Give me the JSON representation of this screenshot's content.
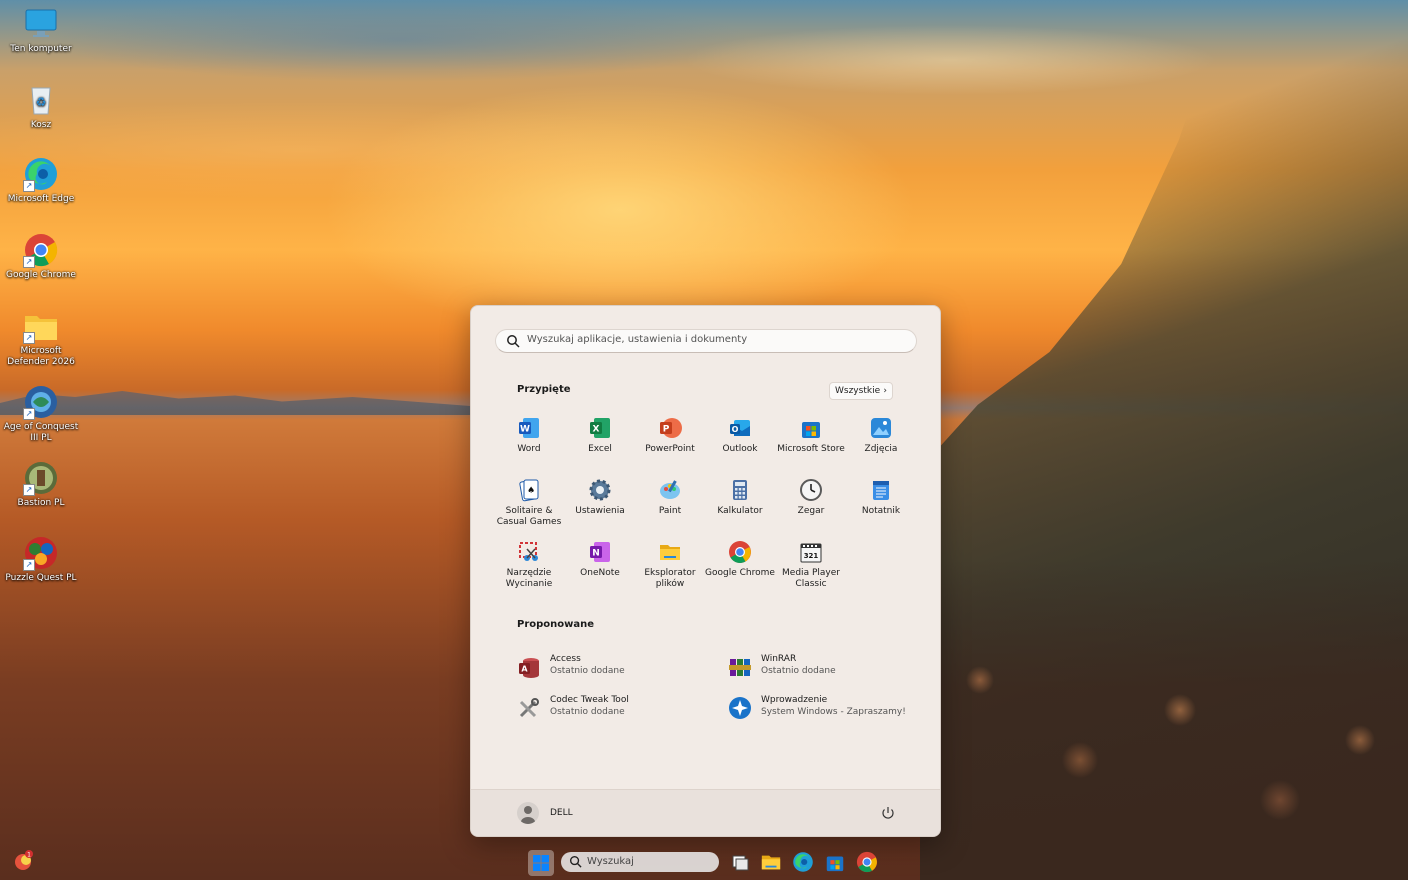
{
  "desktop": {
    "icons": [
      {
        "label": "Ten komputer",
        "icon": "monitor-icon"
      },
      {
        "label": "Kosz",
        "icon": "recycle-bin-icon"
      },
      {
        "label": "Microsoft Edge",
        "icon": "edge-icon"
      },
      {
        "label": "Google Chrome",
        "icon": "chrome-icon"
      },
      {
        "label": "Microsoft Defender 2026",
        "icon": "folder-icon"
      },
      {
        "label": "Age of Conquest III PL",
        "icon": "game-icon"
      },
      {
        "label": "Bastion PL",
        "icon": "game-icon"
      },
      {
        "label": "Puzzle Quest PL",
        "icon": "game-icon"
      }
    ]
  },
  "start_menu": {
    "search_placeholder": "Wyszukaj aplikacje, ustawienia i dokumenty",
    "pinned_title": "Przypięte",
    "all_button": "Wszystkie",
    "pinned": [
      {
        "label": "Word",
        "icon": "word-icon",
        "color": "#185abd"
      },
      {
        "label": "Excel",
        "icon": "excel-icon",
        "color": "#107c41"
      },
      {
        "label": "PowerPoint",
        "icon": "powerpoint-icon",
        "color": "#c43e1c"
      },
      {
        "label": "Outlook",
        "icon": "outlook-icon",
        "color": "#0f6cbd"
      },
      {
        "label": "Microsoft Store",
        "icon": "store-icon",
        "color": "#1a73c9"
      },
      {
        "label": "Zdjęcia",
        "icon": "photos-icon",
        "color": "#2b88d8"
      },
      {
        "label": "Solitaire & Casual Games",
        "icon": "solitaire-icon",
        "color": "#1e5aa8"
      },
      {
        "label": "Ustawienia",
        "icon": "settings-icon",
        "color": "#4f6f8f"
      },
      {
        "label": "Paint",
        "icon": "paint-icon",
        "color": "#2f9cd8"
      },
      {
        "label": "Kalkulator",
        "icon": "calculator-icon",
        "color": "#4a6fa5"
      },
      {
        "label": "Zegar",
        "icon": "clock-icon",
        "color": "#5a5a5a"
      },
      {
        "label": "Notatnik",
        "icon": "notepad-icon",
        "color": "#2a7bd5"
      },
      {
        "label": "Narzędzie Wycinanie",
        "icon": "snipping-tool-icon",
        "color": "#d13438"
      },
      {
        "label": "OneNote",
        "icon": "onenote-icon",
        "color": "#7719aa"
      },
      {
        "label": "Eksplorator plików",
        "icon": "file-explorer-icon",
        "color": "#f2b824"
      },
      {
        "label": "Google Chrome",
        "icon": "chrome-icon",
        "color": "#4285f4"
      },
      {
        "label": "Media Player Classic",
        "icon": "media-player-icon",
        "color": "#3a3a3a"
      }
    ],
    "recommended_title": "Proponowane",
    "recommended": [
      {
        "name": "Access",
        "sub": "Ostatnio dodane",
        "icon": "access-icon",
        "color": "#a4373a"
      },
      {
        "name": "WinRAR",
        "sub": "Ostatnio dodane",
        "icon": "winrar-icon",
        "color": "#8b1e3f"
      },
      {
        "name": "Codec Tweak Tool",
        "sub": "Ostatnio dodane",
        "icon": "tools-icon",
        "color": "#777777"
      },
      {
        "name": "Wprowadzenie",
        "sub": "System Windows - Zapraszamy!",
        "icon": "get-started-icon",
        "color": "#1a73c9"
      }
    ],
    "user_name": "DELL"
  },
  "taskbar": {
    "search_label": "Wyszukaj",
    "items": [
      "start-icon",
      "task-view-icon",
      "file-explorer-icon",
      "edge-icon",
      "store-icon",
      "chrome-icon"
    ]
  }
}
